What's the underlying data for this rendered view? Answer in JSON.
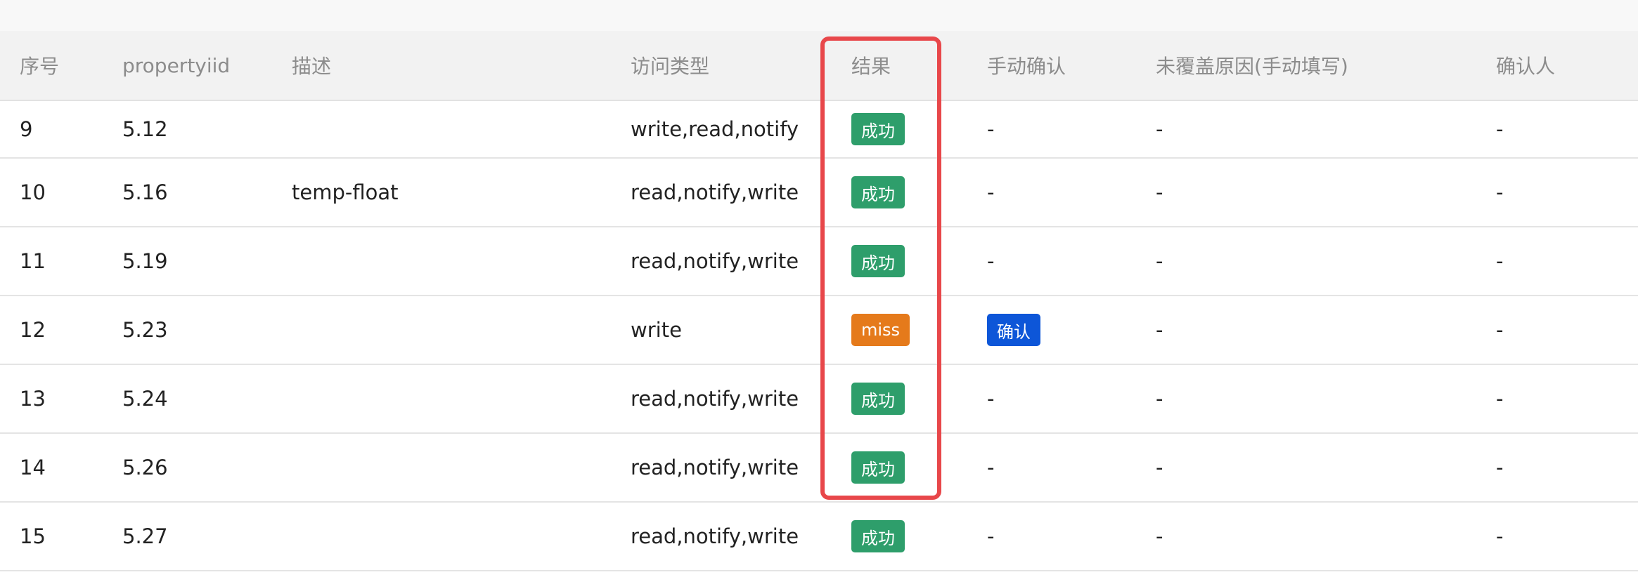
{
  "headers": [
    "序号",
    "propertyiid",
    "描述",
    "访问类型",
    "结果",
    "手动确认",
    "未覆盖原因(手动填写)",
    "确认人"
  ],
  "rows": [
    {
      "no": "9",
      "pid": "5.12",
      "desc": "",
      "access": "write,read,notify",
      "result": "成功",
      "result_type": "success",
      "confirm": "-",
      "reason": "-",
      "confirmer": "-"
    },
    {
      "no": "10",
      "pid": "5.16",
      "desc": "temp-float",
      "access": "read,notify,write",
      "result": "成功",
      "result_type": "success",
      "confirm": "-",
      "reason": "-",
      "confirmer": "-"
    },
    {
      "no": "11",
      "pid": "5.19",
      "desc": "",
      "access": "read,notify,write",
      "result": "成功",
      "result_type": "success",
      "confirm": "-",
      "reason": "-",
      "confirmer": "-"
    },
    {
      "no": "12",
      "pid": "5.23",
      "desc": "",
      "access": "write",
      "result": "miss",
      "result_type": "miss",
      "confirm": "确认",
      "confirm_is_button": true,
      "reason": "-",
      "confirmer": "-"
    },
    {
      "no": "13",
      "pid": "5.24",
      "desc": "",
      "access": "read,notify,write",
      "result": "成功",
      "result_type": "success",
      "confirm": "-",
      "reason": "-",
      "confirmer": "-"
    },
    {
      "no": "14",
      "pid": "5.26",
      "desc": "",
      "access": "read,notify,write",
      "result": "成功",
      "result_type": "success",
      "confirm": "-",
      "reason": "-",
      "confirmer": "-"
    },
    {
      "no": "15",
      "pid": "5.27",
      "desc": "",
      "access": "read,notify,write",
      "result": "成功",
      "result_type": "success",
      "confirm": "-",
      "reason": "-",
      "confirmer": "-"
    }
  ],
  "colors": {
    "success": "#2e9e6b",
    "miss": "#e57a1b",
    "confirm": "#0d56d8",
    "highlight": "#e8474a"
  }
}
